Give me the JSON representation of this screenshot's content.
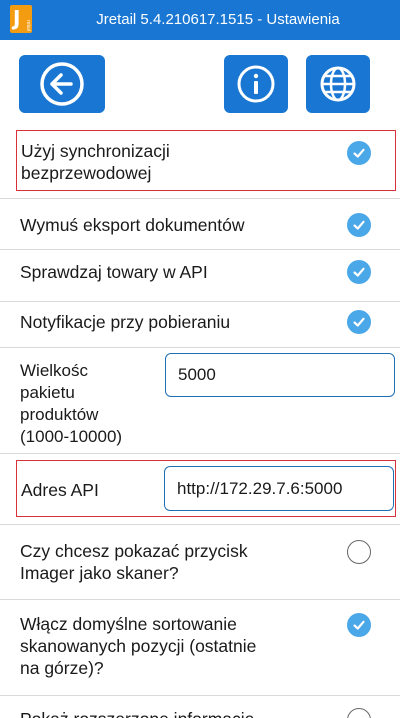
{
  "window": {
    "title": "Jretail 5.4.210617.1515 - Ustawienia",
    "logo_letter": "J",
    "logo_small": "retail"
  },
  "colors": {
    "primary": "#1976d2",
    "check": "#4aa7e8",
    "highlight": "#d9303a",
    "logo": "#f39c12"
  },
  "toolbar": {
    "back_icon": "arrow-left-icon",
    "info_icon": "info-icon",
    "language_icon": "globe-icon"
  },
  "settings": {
    "wireless_sync": {
      "label_line1": "Użyj synchronizacji",
      "label_line2": "bezprzewodowej",
      "checked": true
    },
    "force_export": {
      "label": "Wymuś eksport dokumentów",
      "checked": true
    },
    "check_api": {
      "label": "Sprawdzaj towary w API",
      "checked": true
    },
    "notifications": {
      "label": "Notyfikacje przy pobieraniu",
      "checked": true
    },
    "packet_size": {
      "label_line1": "Wielkośc",
      "label_line2": "pakietu",
      "label_line3": "produktów",
      "label_line4": "(1000-10000)",
      "value": "5000"
    },
    "api_address": {
      "label": "Adres API",
      "value": "http://172.29.7.6:5000"
    },
    "imager_scanner": {
      "label_line1": "Czy chcesz pokazać przycisk",
      "label_line2": "Imager jako skaner?",
      "checked": false
    },
    "default_sort": {
      "label_line1": "Włącz domyślne sortowanie",
      "label_line2": "skanowanych pozycji (ostatnie",
      "label_line3": "na górze)?",
      "checked": true
    },
    "extended_info": {
      "label": "Pokaż rozszerzone informacje",
      "checked": false
    }
  }
}
